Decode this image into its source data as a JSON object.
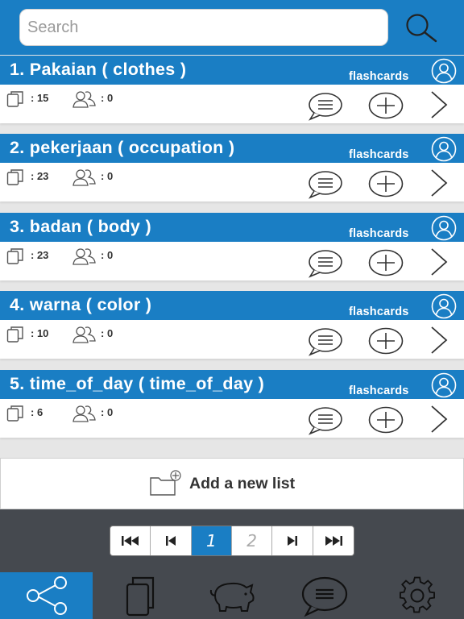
{
  "search": {
    "placeholder": "Search"
  },
  "lists": [
    {
      "title": "1. Pakaian ( clothes )",
      "badge": "flashcards",
      "cards": ": 15",
      "people": ": 0"
    },
    {
      "title": "2. pekerjaan ( occupation )",
      "badge": "flashcards",
      "cards": ": 23",
      "people": ": 0"
    },
    {
      "title": "3. badan ( body )",
      "badge": "flashcards",
      "cards": ": 23",
      "people": ": 0"
    },
    {
      "title": "4. warna ( color )",
      "badge": "flashcards",
      "cards": ": 10",
      "people": ": 0"
    },
    {
      "title": "5. time_of_day ( time_of_day )",
      "badge": "flashcards",
      "cards": ": 6",
      "people": ": 0"
    }
  ],
  "add_list": {
    "label": "Add a new list"
  },
  "pagination": {
    "current_page": "1",
    "next_page": "2"
  },
  "tabs": [
    {
      "icon": "share-icon",
      "active": true
    },
    {
      "icon": "cards-icon",
      "active": false
    },
    {
      "icon": "piggy-bank-icon",
      "active": false
    },
    {
      "icon": "chat-icon",
      "active": false
    },
    {
      "icon": "gear-icon",
      "active": false
    }
  ],
  "colors": {
    "primary": "#1a7ec4",
    "dark": "#45494f",
    "background": "#e6e6e6"
  }
}
